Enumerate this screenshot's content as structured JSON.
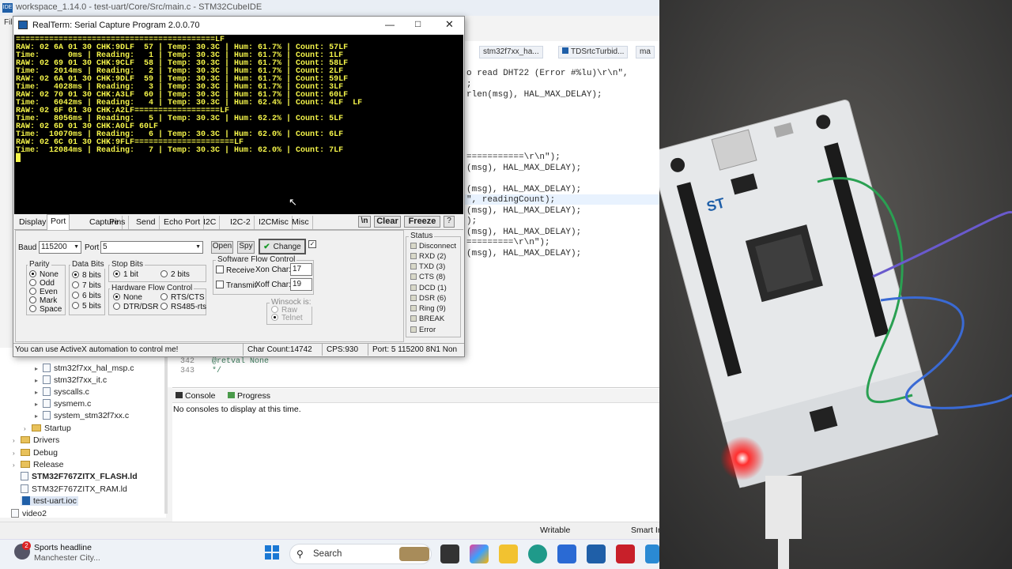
{
  "ide": {
    "title": "workspace_1.14.0 - test-uart/Core/Src/main.c - STM32CubeIDE",
    "logo": "IDE",
    "menu_fragment": "Fil",
    "editor_tabs": [
      "stm32f7xx_ha...",
      "TDSrtcTurbid...",
      "ma"
    ],
    "code_lines": [
      "o read DHT22 (Error #%lu)\\r\\n\",",
      ";",
      "rlen(msg), HAL_MAX_DELAY);",
      "===========\\r\\n\");",
      "(msg), HAL_MAX_DELAY);",
      "(msg), HAL_MAX_DELAY);",
      "\", readingCount);",
      "(msg), HAL_MAX_DELAY);",
      ");",
      "(msg), HAL_MAX_DELAY);",
      "=========\\r\\n\");",
      "(msg), HAL_MAX_DELAY);"
    ],
    "line_numbers": [
      "342",
      "343"
    ],
    "line_code": [
      "  @retval None",
      "  */"
    ],
    "project_tree": [
      {
        "type": "file",
        "label": "stm32f7xx_hal_msp.c"
      },
      {
        "type": "file",
        "label": "stm32f7xx_it.c"
      },
      {
        "type": "file",
        "label": "syscalls.c"
      },
      {
        "type": "file",
        "label": "sysmem.c"
      },
      {
        "type": "file",
        "label": "system_stm32f7xx.c"
      },
      {
        "type": "folder",
        "label": "Startup"
      },
      {
        "type": "folder",
        "label": "Drivers"
      },
      {
        "type": "folder",
        "label": "Debug"
      },
      {
        "type": "folder",
        "label": "Release"
      },
      {
        "type": "file",
        "label": "STM32F767ZITX_FLASH.ld"
      },
      {
        "type": "file",
        "label": "STM32F767ZITX_RAM.ld"
      },
      {
        "type": "file",
        "label": "test-uart.ioc"
      },
      {
        "type": "file",
        "label": "video2"
      }
    ],
    "console_tab": "Console",
    "progress_tab": "Progress",
    "console_message": "No consoles to display at this time.",
    "status_writable": "Writable",
    "status_insert": "Smart In"
  },
  "taskbar": {
    "news_badge": "2",
    "news_title": "Sports headline",
    "news_sub": "Manchester City...",
    "search_placeholder": "Search"
  },
  "realterm": {
    "title": "RealTerm: Serial Capture Program 2.0.0.70",
    "terminal_text": "==========================================LF\nRAW: 02 6A 01 30 CHK:9DLF  57 | Temp: 30.3C | Hum: 61.7% | Count: 57LF\nTime:      0ms | Reading:   1 | Temp: 30.3C | Hum: 61.7% | Count: 1LF\nRAW: 02 69 01 30 CHK:9CLF  58 | Temp: 30.3C | Hum: 61.7% | Count: 58LF\nTime:   2014ms | Reading:   2 | Temp: 30.3C | Hum: 61.7% | Count: 2LF\nRAW: 02 6A 01 30 CHK:9DLF  59 | Temp: 30.3C | Hum: 61.7% | Count: 59LF\nTime:   4028ms | Reading:   3 | Temp: 30.3C | Hum: 61.7% | Count: 3LF\nRAW: 02 70 01 30 CHK:A3LF  60 | Temp: 30.3C | Hum: 61.7% | Count: 60LF\nTime:   6042ms | Reading:   4 | Temp: 30.3C | Hum: 62.4% | Count: 4LF  LF\nRAW: 02 6F 01 30 CHK:A2LF==================LF\nTime:   8056ms | Reading:   5 | Temp: 30.3C | Hum: 62.2% | Count: 5LF\nRAW: 02 6D 01 30 CHK:A0LF 60LF\nTime:  10070ms | Reading:   6 | Temp: 30.3C | Hum: 62.0% | Count: 6LF\nRAW: 02 6C 01 30 CHK:9FLF=====================LF\nTime:  12084ms | Reading:   7 | Temp: 30.3C | Hum: 62.0% | Count: 7LF\n█",
    "tabs": [
      "Display",
      "Port",
      "Capture",
      "Pins",
      "Send",
      "Echo Port",
      "I2C",
      "I2C-2",
      "I2CMisc",
      "Misc"
    ],
    "btn_n": "\\n",
    "btn_clear": "Clear",
    "btn_freeze": "Freeze",
    "btn_help": "?",
    "baud_label": "Baud",
    "baud_value": "115200",
    "port_label": "Port",
    "port_value": "5",
    "btn_open": "Open",
    "btn_spy": "Spy",
    "btn_change": "Change",
    "parity": {
      "title": "Parity",
      "options": [
        "None",
        "Odd",
        "Even",
        "Mark",
        "Space"
      ],
      "selected": "None"
    },
    "databits": {
      "title": "Data Bits",
      "options": [
        "8 bits",
        "7 bits",
        "6 bits",
        "5 bits"
      ],
      "selected": "8 bits"
    },
    "stopbits": {
      "title": "Stop Bits",
      "options": [
        "1 bit",
        "2 bits"
      ],
      "selected": "1 bit"
    },
    "hwflow": {
      "title": "Hardware Flow Control",
      "options": [
        "None",
        "RTS/CTS",
        "DTR/DSR",
        "RS485-rts"
      ],
      "selected": "None"
    },
    "swflow": {
      "title": "Software Flow Control",
      "receive": "Receive",
      "transmit": "Transmit",
      "xon_label": "Xon Char:",
      "xon_value": "17",
      "xoff_label": "Xoff Char:",
      "xoff_value": "19"
    },
    "winsock": {
      "title": "Winsock is:",
      "options": [
        "Raw",
        "Telnet"
      ]
    },
    "status": {
      "title": "Status",
      "items": [
        "Disconnect",
        "RXD (2)",
        "TXD (3)",
        "CTS (8)",
        "DCD (1)",
        "DSR (6)",
        "Ring (9)",
        "BREAK",
        "Error"
      ]
    },
    "statusbar": {
      "msg": "You can use ActiveX automation to control me!",
      "chars": "Char Count:14742",
      "cps": "CPS:930",
      "port": "Port: 5 115200 8N1 Non"
    }
  },
  "photo": {
    "board_logo": "ST"
  },
  "colors": {
    "terminal_bg": "#000000",
    "terminal_text": "#f5f54a",
    "accent": "#1f5fa8",
    "led": "#ff2a2a"
  }
}
